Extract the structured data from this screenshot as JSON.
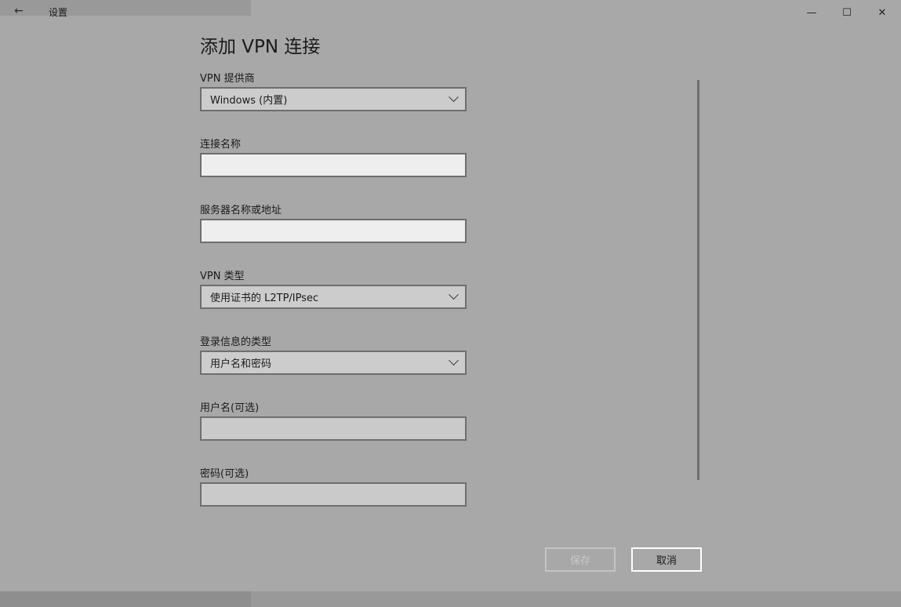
{
  "window": {
    "app_title": "设置",
    "back_icon": "←",
    "min_icon": "—",
    "max_icon": "☐",
    "close_icon": "✕"
  },
  "page": {
    "title": "添加 VPN 连接"
  },
  "form": {
    "provider": {
      "label": "VPN 提供商",
      "value": "Windows (内置)"
    },
    "connection_name": {
      "label": "连接名称",
      "value": ""
    },
    "server": {
      "label": "服务器名称或地址",
      "value": ""
    },
    "vpn_type": {
      "label": "VPN 类型",
      "value": "使用证书的 L2TP/IPsec"
    },
    "signin_type": {
      "label": "登录信息的类型",
      "value": "用户名和密码"
    },
    "username": {
      "label": "用户名(可选)",
      "value": ""
    },
    "password": {
      "label": "密码(可选)",
      "value": ""
    }
  },
  "actions": {
    "save_label": "保存",
    "cancel_label": "取消"
  },
  "colors": {
    "background": "#a8a8a8",
    "field_border": "#6e6e6e",
    "button_border": "#ffffff"
  }
}
